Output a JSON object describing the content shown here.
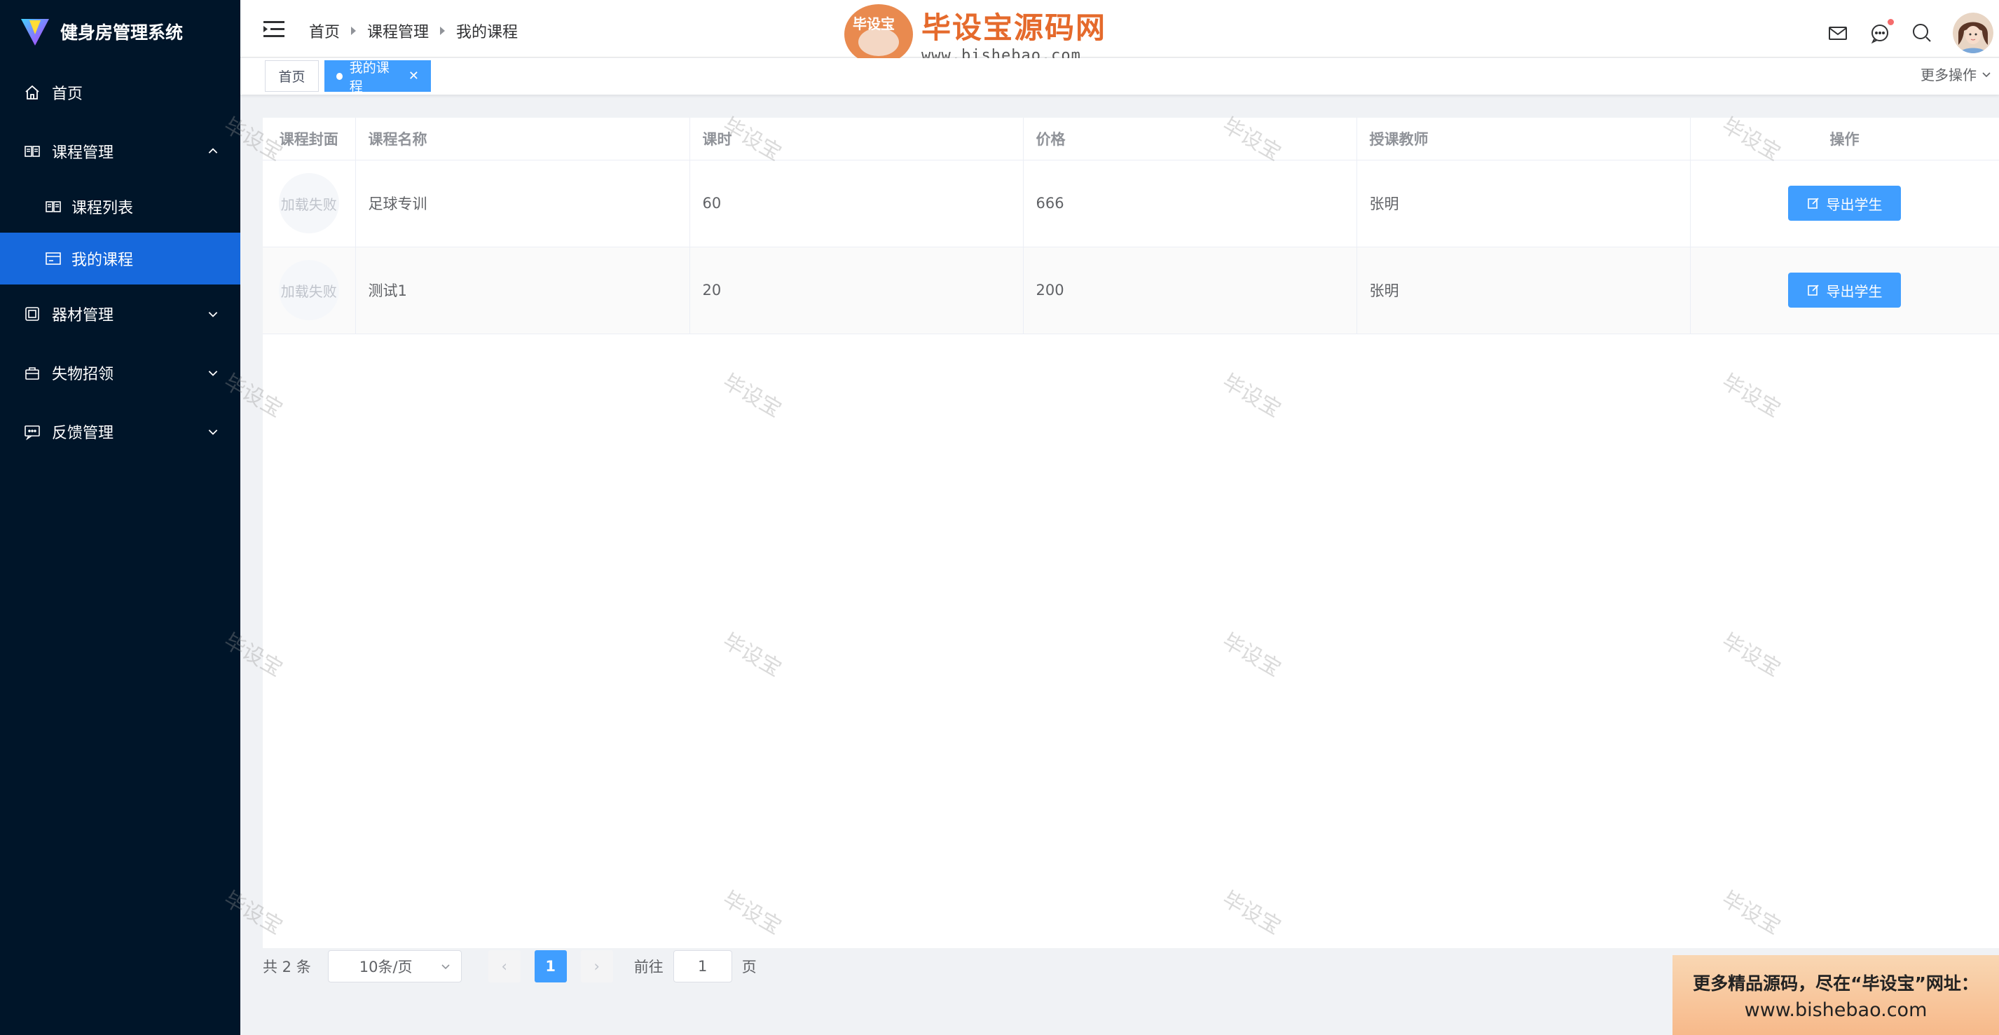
{
  "app": {
    "title": "健身房管理系统"
  },
  "sidebar": {
    "items": [
      {
        "label": "首页",
        "icon": "home-icon"
      },
      {
        "label": "课程管理",
        "icon": "book-icon",
        "expanded": true,
        "children": [
          {
            "label": "课程列表",
            "icon": "book-icon",
            "active": false
          },
          {
            "label": "我的课程",
            "icon": "window-icon",
            "active": true
          }
        ]
      },
      {
        "label": "器材管理",
        "icon": "equipment-icon",
        "expanded": false
      },
      {
        "label": "失物招领",
        "icon": "bag-icon",
        "expanded": false
      },
      {
        "label": "反馈管理",
        "icon": "chat-icon",
        "expanded": false
      }
    ]
  },
  "header": {
    "breadcrumb": [
      "首页",
      "课程管理",
      "我的课程"
    ],
    "icons": [
      "mail-icon",
      "chat-icon",
      "search-icon"
    ],
    "has_notification": true
  },
  "site_logo": {
    "badge": "毕设宝",
    "name": "毕设宝源码网",
    "url": "www.bishebao.com"
  },
  "tags": {
    "home": "首页",
    "active": "我的课程",
    "more": "更多操作"
  },
  "table": {
    "columns": [
      "课程封面",
      "课程名称",
      "课时",
      "价格",
      "授课教师",
      "操作"
    ],
    "rows": [
      {
        "cover": "加载失败",
        "name": "足球专训",
        "hours": "60",
        "price": "666",
        "teacher": "张明",
        "action": "导出学生"
      },
      {
        "cover": "加载失败",
        "name": "测试1",
        "hours": "20",
        "price": "200",
        "teacher": "张明",
        "action": "导出学生"
      }
    ]
  },
  "pagination": {
    "total": "共 2 条",
    "page_size": "10条/页",
    "current": "1",
    "goto_label": "前往",
    "goto_value": "1",
    "page_suffix": "页"
  },
  "ad": {
    "line1": "更多精品源码，尽在“毕设宝”网址：",
    "line2": "www.bishebao.com"
  },
  "watermark": "毕设宝",
  "colors": {
    "sidebar_bg": "#001529",
    "active_menu": "#1668dc",
    "primary": "#409eff"
  }
}
